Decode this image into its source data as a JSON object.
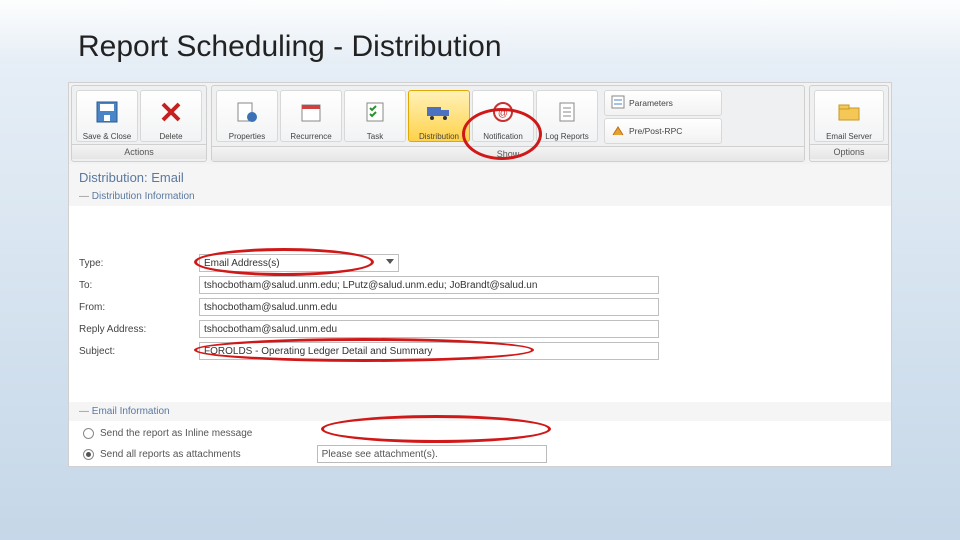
{
  "title": "Report Scheduling - Distribution",
  "ribbon": {
    "groups": {
      "actions": {
        "label": "Actions",
        "save_close": "Save & Close",
        "delete": "Delete"
      },
      "show": {
        "label": "Show",
        "properties": "Properties",
        "recurrence": "Recurrence",
        "task": "Task",
        "distribution": "Distribution",
        "notification": "Notification",
        "log_reports": "Log Reports"
      },
      "sidecol": {
        "parameters": "Parameters",
        "pre_post_rpc": "Pre/Post-RPC"
      },
      "options": {
        "label": "Options",
        "email_server": "Email Server"
      }
    }
  },
  "panel": {
    "heading": "Distribution: Email"
  },
  "sections": {
    "dist_info": "Distribution Information",
    "email_info": "Email Information"
  },
  "form": {
    "type_label": "Type:",
    "type_value": "Email Address(s)",
    "to_label": "To:",
    "to_value": "tshocbotham@salud.unm.edu; LPutz@salud.unm.edu; JoBrandt@salud.un",
    "from_label": "From:",
    "from_value": "tshocbotham@salud.unm.edu",
    "reply_label": "Reply Address:",
    "reply_value": "tshocbotham@salud.unm.edu",
    "subject_label": "Subject:",
    "subject_value": "FOROLDS - Operating Ledger Detail and Summary"
  },
  "email_options": {
    "inline": "Send the report as Inline message",
    "attachments": "Send all reports as attachments",
    "attach_text": "Please see attachment(s).",
    "selected": "attachments"
  }
}
